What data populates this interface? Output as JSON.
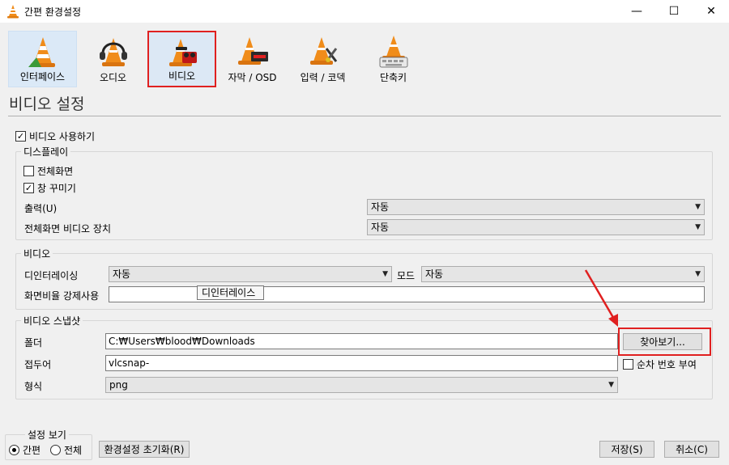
{
  "window": {
    "title": "간편 환경설정",
    "minimize_glyph": "—",
    "maximize_glyph": "☐",
    "close_glyph": "✕"
  },
  "categories": [
    {
      "label": "인터페이스",
      "icon": "interface-cone-icon"
    },
    {
      "label": "오디오",
      "icon": "audio-headphones-icon"
    },
    {
      "label": "비디오",
      "icon": "video-cone-icon"
    },
    {
      "label": "자막 / OSD",
      "icon": "subtitle-cone-icon"
    },
    {
      "label": "입력 / 코덱",
      "icon": "input-codec-cone-icon"
    },
    {
      "label": "단축키",
      "icon": "hotkeys-cone-icon"
    }
  ],
  "section_title": "비디오 설정",
  "enable_video": {
    "label": "비디오 사용하기",
    "checked": true
  },
  "display": {
    "legend": "디스플레이",
    "fullscreen": {
      "label": "전체화면",
      "checked": false
    },
    "decorations": {
      "label": "창 꾸미기",
      "checked": true
    },
    "output": {
      "label": "출력(U)",
      "value": "자동"
    },
    "fullscreen_device": {
      "label": "전체화면 비디오 장치",
      "value": "자동"
    }
  },
  "video": {
    "legend": "비디오",
    "deinterlace": {
      "label": "디인터레이싱",
      "value": "자동"
    },
    "mode": {
      "label": "모드",
      "value": "자동"
    },
    "aspect": {
      "label": "화면비율 강제사용",
      "value": ""
    },
    "tooltip": "디인터레이스"
  },
  "snapshot": {
    "legend": "비디오 스냅샷",
    "folder": {
      "label": "폴더",
      "value": "C:₩Users₩blood₩Downloads"
    },
    "browse_label": "찾아보기...",
    "prefix": {
      "label": "접두어",
      "value": "vlcsnap-"
    },
    "sequential": {
      "label": "순차 번호 부여",
      "checked": false
    },
    "format": {
      "label": "형식",
      "value": "png"
    }
  },
  "show_settings": {
    "legend": "설정 보기",
    "simple": "간편",
    "all": "전체",
    "selected": "simple"
  },
  "buttons": {
    "reset": "환경설정 초기화(R)",
    "save": "저장(S)",
    "cancel": "취소(C)"
  },
  "colors": {
    "highlight_red": "#e02020",
    "cone_orange": "#f08c1a",
    "selected_bg": "#dce8f5"
  }
}
